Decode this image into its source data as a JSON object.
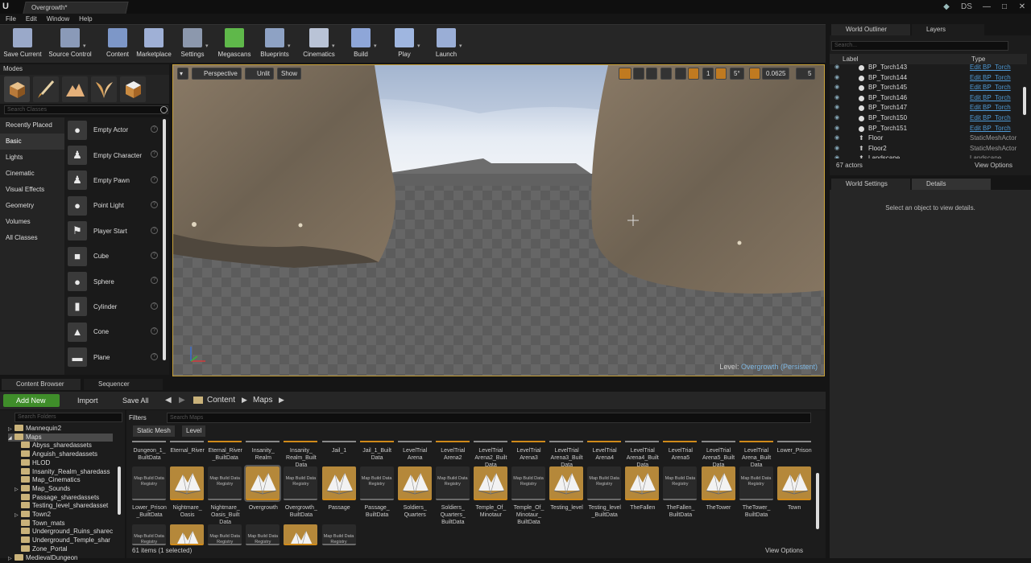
{
  "titlebar": {
    "logo": "U",
    "tab": "Overgrowth*",
    "user_badge": "DS",
    "min": "—",
    "max": "□",
    "close": "✕"
  },
  "menu": [
    "File",
    "Edit",
    "Window",
    "Help"
  ],
  "toolbar": [
    {
      "label": "Save Current",
      "color": "#9aa9c9"
    },
    {
      "label": "Source Control",
      "color": "#8a9ab8"
    },
    {
      "label": "Content",
      "color": "#7d97c8"
    },
    {
      "label": "Marketplace",
      "color": "#9fb0d6"
    },
    {
      "label": "Settings",
      "color": "#8c98ad"
    },
    {
      "label": "Megascans",
      "color": "#5fb84a"
    },
    {
      "label": "Blueprints",
      "color": "#8ea2c4"
    },
    {
      "label": "Cinematics",
      "color": "#b9c3d6"
    },
    {
      "label": "Build",
      "color": "#8ea6d8"
    },
    {
      "label": "Play",
      "color": "#9fb6e0"
    },
    {
      "label": "Launch",
      "color": "#9aaed6"
    }
  ],
  "modes": {
    "tab": "Modes",
    "search_placeholder": "Search Classes",
    "categories": [
      "Recently Placed",
      "Basic",
      "Lights",
      "Cinematic",
      "Visual Effects",
      "Geometry",
      "Volumes",
      "All Classes"
    ],
    "selected_category": "Basic",
    "classes": [
      "Empty Actor",
      "Empty Character",
      "Empty Pawn",
      "Point Light",
      "Player Start",
      "Cube",
      "Sphere",
      "Cylinder",
      "Cone",
      "Plane"
    ],
    "help": "?"
  },
  "viewport": {
    "dropdown": "▾",
    "perspective": "Perspective",
    "unlit": "Unlit",
    "show": "Show",
    "grid_snap": "1",
    "angle_snap": "5°",
    "scale_snap": "0.0625",
    "camera_speed": "5",
    "level_label": "Level:",
    "level_name": "Overgrowth (Persistent)"
  },
  "outliner": {
    "tab": "World Outliner",
    "tab2": "Layers",
    "search_placeholder": "Search...",
    "col_label": "Label",
    "col_type": "Type",
    "rows": [
      {
        "name": "BP_Torch143",
        "type": "Edit BP_Torch",
        "link": true
      },
      {
        "name": "BP_Torch144",
        "type": "Edit BP_Torch",
        "link": true
      },
      {
        "name": "BP_Torch145",
        "type": "Edit BP_Torch",
        "link": true
      },
      {
        "name": "BP_Torch146",
        "type": "Edit BP_Torch",
        "link": true
      },
      {
        "name": "BP_Torch147",
        "type": "Edit BP_Torch",
        "link": true
      },
      {
        "name": "BP_Torch150",
        "type": "Edit BP_Torch",
        "link": true
      },
      {
        "name": "BP_Torch151",
        "type": "Edit BP_Torch",
        "link": true
      },
      {
        "name": "Floor",
        "type": "StaticMeshActor",
        "link": false
      },
      {
        "name": "Floor2",
        "type": "StaticMeshActor",
        "link": false
      },
      {
        "name": "Landscape",
        "type": "Landscape",
        "link": false
      }
    ],
    "count": "67 actors",
    "view_options": "View Options"
  },
  "details": {
    "tab1": "World Settings",
    "tab2": "Details",
    "empty_message": "Select an object to view details."
  },
  "content_browser": {
    "tab1": "Content Browser",
    "tab2": "Sequencer",
    "add_new": "Add New",
    "import": "Import",
    "save_all": "Save All",
    "path": [
      "Content",
      "Maps"
    ],
    "folder_search": "Search Folders",
    "folders": [
      {
        "name": "Mannequin2",
        "depth": 1,
        "arrow": "▷"
      },
      {
        "name": "Maps",
        "depth": 1,
        "arrow": "◢",
        "selected": true
      },
      {
        "name": "Abyss_sharedassets",
        "depth": 2,
        "arrow": ""
      },
      {
        "name": "Anguish_sharedassets",
        "depth": 2,
        "arrow": ""
      },
      {
        "name": "HLOD",
        "depth": 2,
        "arrow": ""
      },
      {
        "name": "Insanity_Realm_sharedass",
        "depth": 2,
        "arrow": ""
      },
      {
        "name": "Map_Cinematics",
        "depth": 2,
        "arrow": ""
      },
      {
        "name": "Map_Sounds",
        "depth": 2,
        "arrow": "▷"
      },
      {
        "name": "Passage_sharedassets",
        "depth": 2,
        "arrow": ""
      },
      {
        "name": "Testing_level_sharedasset",
        "depth": 2,
        "arrow": ""
      },
      {
        "name": "Town2",
        "depth": 2,
        "arrow": "▷"
      },
      {
        "name": "Town_mats",
        "depth": 2,
        "arrow": ""
      },
      {
        "name": "Underground_Ruins_sharec",
        "depth": 2,
        "arrow": ""
      },
      {
        "name": "Underground_Temple_shar",
        "depth": 2,
        "arrow": ""
      },
      {
        "name": "Zone_Portal",
        "depth": 2,
        "arrow": ""
      },
      {
        "name": "MedievalDungeon",
        "depth": 1,
        "arrow": "▷"
      }
    ],
    "filters": "Filters",
    "search_placeholder": "Search Maps",
    "chips": [
      "Static Mesh",
      "Level"
    ],
    "tile_text": "Map Build Data Registry",
    "row1_labels": [
      "Dungeon_1_\nBuiltData",
      "Eternal_River",
      "Eternal_River\n_BuiltData",
      "Insanity_\nRealm",
      "Insanity_\nRealm_Built\nData",
      "Jail_1",
      "Jail_1_Built\nData",
      "LevelTrial\nArena",
      "LevelTrial\nArena2",
      "LevelTrial\nArena2_Built\nData",
      "LevelTrial\nArena3",
      "LevelTrial\nArena3_Built\nData",
      "LevelTrial\nArena4",
      "LevelTrial\nArena4_Built\nData",
      "LevelTrial\nArena5",
      "LevelTrial\nArena5_Built\nData",
      "LevelTrial\nArena_Built\nData",
      "Lower_Prison"
    ],
    "row2_labels": [
      "Lower_Prison\n_BuiltData",
      "Nightmare_\nOasis",
      "Nightmare_\nOasis_Built\nData",
      "Overgrowth",
      "Overgrowth_\nBuiltData",
      "Passage",
      "Passage_\nBuiltData",
      "Soldiers_\nQuarters",
      "Soldiers_\nQuarters_\nBuiltData",
      "Temple_Of_\nMinotaur",
      "Temple_Of_\nMinotaur_\nBuiltData",
      "Testing_level",
      "Testing_level\n_BuiltData",
      "TheFallen",
      "TheFallen_\nBuiltData",
      "TheTower",
      "TheTower_\nBuiltData",
      "Town"
    ],
    "row2_types": [
      "reg",
      "map",
      "reg",
      "map",
      "reg",
      "map",
      "reg",
      "map",
      "reg",
      "map",
      "reg",
      "map",
      "reg",
      "map",
      "reg",
      "map",
      "reg",
      "map"
    ],
    "row3_types": [
      "reg",
      "map",
      "reg",
      "reg",
      "map",
      "reg"
    ],
    "status": "61 items (1 selected)",
    "view_options": "View Options"
  },
  "colors": {
    "accent": "#c9a23a",
    "link": "#4f9ad6",
    "add_new": "#3f8d2a",
    "folder": "#c9b27a",
    "map_tile": "#b5883a"
  }
}
